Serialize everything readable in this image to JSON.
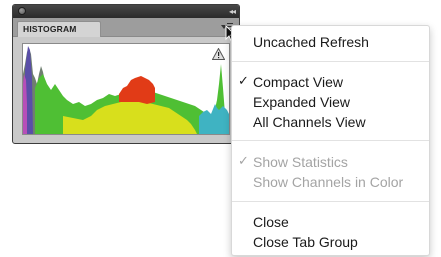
{
  "panel": {
    "collapse_glyph": "◂◂",
    "tab_label": "HISTOGRAM",
    "icons": {
      "close": "close-dot-icon",
      "collapse": "collapse-arrows-icon",
      "menu": "panel-menu-icon",
      "warning": "warning-triangle-icon"
    },
    "histogram_colors": {
      "gray": "#6f7f70",
      "green": "#4fbf34",
      "yellow": "#d8df1c",
      "red": "#e13b17",
      "cyan": "#3fb3c2",
      "blue": "#5a4ea8",
      "magenta": "#b74fb8"
    }
  },
  "menu": {
    "items": [
      {
        "label": "Uncached Refresh",
        "checked": false,
        "enabled": true
      },
      {
        "label": "Compact View",
        "checked": true,
        "enabled": true
      },
      {
        "label": "Expanded View",
        "checked": false,
        "enabled": true
      },
      {
        "label": "All Channels View",
        "checked": false,
        "enabled": true
      },
      {
        "label": "Show Statistics",
        "checked": true,
        "enabled": false
      },
      {
        "label": "Show Channels in Color",
        "checked": false,
        "enabled": false
      },
      {
        "label": "Close",
        "checked": false,
        "enabled": true
      },
      {
        "label": "Close Tab Group",
        "checked": false,
        "enabled": true
      }
    ],
    "check_glyph": "✓"
  }
}
